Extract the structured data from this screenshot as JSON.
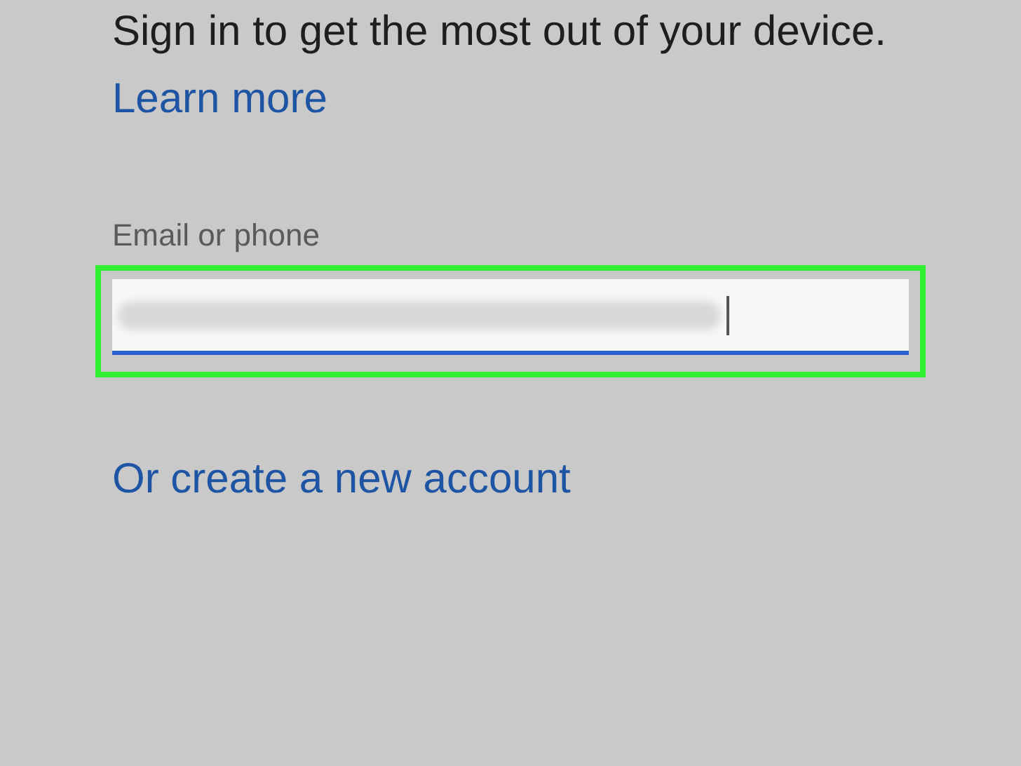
{
  "intro": {
    "text": "Sign in to get the most out of your device.",
    "link": "Learn more"
  },
  "email_field": {
    "label": "Email or phone",
    "focused": true,
    "value_blurred": true,
    "highlighted": true
  },
  "create_account_link": "Or create a new account"
}
